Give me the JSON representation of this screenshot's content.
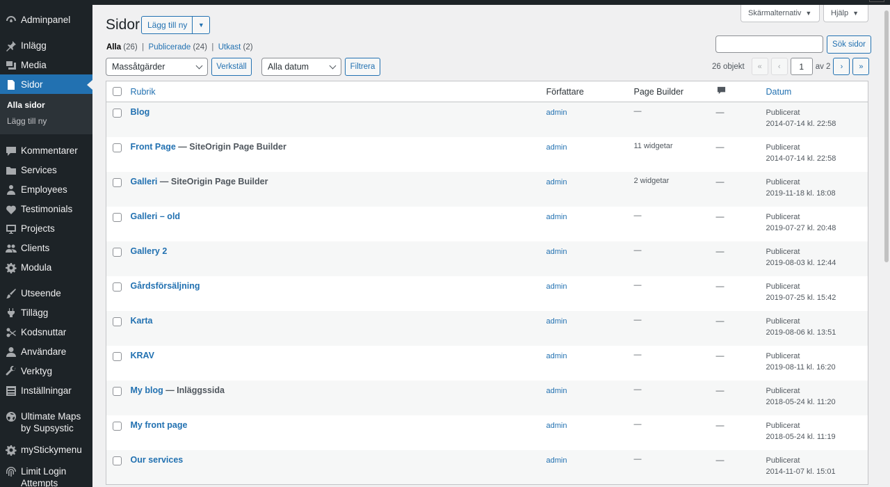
{
  "sidebar": {
    "items": [
      {
        "key": "dashboard",
        "label": "Adminpanel",
        "icon": "dashboard-icon"
      },
      {
        "key": "posts",
        "label": "Inlägg",
        "icon": "pin-icon"
      },
      {
        "key": "media",
        "label": "Media",
        "icon": "media-icon"
      },
      {
        "key": "pages",
        "label": "Sidor",
        "icon": "page-icon"
      },
      {
        "key": "comments",
        "label": "Kommentarer",
        "icon": "comment-icon"
      },
      {
        "key": "services",
        "label": "Services",
        "icon": "folder-icon"
      },
      {
        "key": "employees",
        "label": "Employees",
        "icon": "person-icon"
      },
      {
        "key": "testimonials",
        "label": "Testimonials",
        "icon": "heart-icon"
      },
      {
        "key": "projects",
        "label": "Projects",
        "icon": "monitor-icon"
      },
      {
        "key": "clients",
        "label": "Clients",
        "icon": "group-icon"
      },
      {
        "key": "modula",
        "label": "Modula",
        "icon": "gear-icon"
      },
      {
        "key": "appearance",
        "label": "Utseende",
        "icon": "brush-icon"
      },
      {
        "key": "plugins",
        "label": "Tillägg",
        "icon": "plug-icon"
      },
      {
        "key": "snippets",
        "label": "Kodsnuttar",
        "icon": "scissors-icon"
      },
      {
        "key": "users",
        "label": "Användare",
        "icon": "user-icon"
      },
      {
        "key": "tools",
        "label": "Verktyg",
        "icon": "wrench-icon"
      },
      {
        "key": "settings",
        "label": "Inställningar",
        "icon": "settings-icon"
      },
      {
        "key": "maps",
        "label": "Ultimate Maps by Supsystic",
        "icon": "globe-icon"
      },
      {
        "key": "sticky",
        "label": "myStickymenu",
        "icon": "gear-icon"
      },
      {
        "key": "limitlogin",
        "label": "Limit Login Attempts",
        "icon": "fingerprint-icon"
      }
    ],
    "submenu": [
      "Alla sidor",
      "Lägg till ny"
    ]
  },
  "top": {
    "screen_options": "Skärmalternativ",
    "help": "Hjälp"
  },
  "header": {
    "title": "Sidor",
    "add_new": "Lägg till ny"
  },
  "filters": {
    "all": "Alla",
    "all_count": "(26)",
    "published": "Publicerade",
    "published_count": "(24)",
    "drafts": "Utkast",
    "drafts_count": "(2)",
    "sep": "|"
  },
  "search": {
    "placeholder": "",
    "button": "Sök sidor"
  },
  "bulk": {
    "selected": "Massåtgärder",
    "apply": "Verkställ"
  },
  "dates": {
    "selected": "Alla datum",
    "filter": "Filtrera"
  },
  "pagination": {
    "items": "26 objekt",
    "first": "«",
    "prev": "‹",
    "current": "1",
    "of": "av 2",
    "next": "›",
    "last": "»"
  },
  "table": {
    "headers": {
      "title": "Rubrik",
      "author": "Författare",
      "page_builder": "Page Builder",
      "date": "Datum"
    },
    "rows": [
      {
        "title": "Blog",
        "suffix": "",
        "author": "admin",
        "pb": "—",
        "comments": "—",
        "status": "Publicerat",
        "date": "2014-07-14 kl. 22:58"
      },
      {
        "title": "Front Page",
        "suffix": " — SiteOrigin Page Builder",
        "author": "admin",
        "pb": "11 widgetar",
        "comments": "—",
        "status": "Publicerat",
        "date": "2014-07-14 kl. 22:58"
      },
      {
        "title": "Galleri",
        "suffix": " — SiteOrigin Page Builder",
        "author": "admin",
        "pb": "2 widgetar",
        "comments": "—",
        "status": "Publicerat",
        "date": "2019-11-18 kl. 18:08"
      },
      {
        "title": "Galleri – old",
        "suffix": "",
        "author": "admin",
        "pb": "—",
        "comments": "—",
        "status": "Publicerat",
        "date": "2019-07-27 kl. 20:48"
      },
      {
        "title": "Gallery 2",
        "suffix": "",
        "author": "admin",
        "pb": "—",
        "comments": "—",
        "status": "Publicerat",
        "date": "2019-08-03 kl. 12:44"
      },
      {
        "title": "Gårdsförsäljning",
        "suffix": "",
        "author": "admin",
        "pb": "—",
        "comments": "—",
        "status": "Publicerat",
        "date": "2019-07-25 kl. 15:42"
      },
      {
        "title": "Karta",
        "suffix": "",
        "author": "admin",
        "pb": "—",
        "comments": "—",
        "status": "Publicerat",
        "date": "2019-08-06 kl. 13:51"
      },
      {
        "title": "KRAV",
        "suffix": "",
        "author": "admin",
        "pb": "—",
        "comments": "—",
        "status": "Publicerat",
        "date": "2019-08-11 kl. 16:20"
      },
      {
        "title": "My blog",
        "suffix": " — Inläggssida",
        "author": "admin",
        "pb": "—",
        "comments": "—",
        "status": "Publicerat",
        "date": "2018-05-24 kl. 11:20"
      },
      {
        "title": "My front page",
        "suffix": "",
        "author": "admin",
        "pb": "—",
        "comments": "—",
        "status": "Publicerat",
        "date": "2018-05-24 kl. 11:19"
      },
      {
        "title": "Our services",
        "suffix": "",
        "author": "admin",
        "pb": "—",
        "comments": "—",
        "status": "Publicerat",
        "date": "2014-11-07 kl. 15:01"
      }
    ]
  },
  "colors": {
    "accent": "#2271b1",
    "sidebar_bg": "#1d2327",
    "submenu_bg": "#2c3338"
  }
}
